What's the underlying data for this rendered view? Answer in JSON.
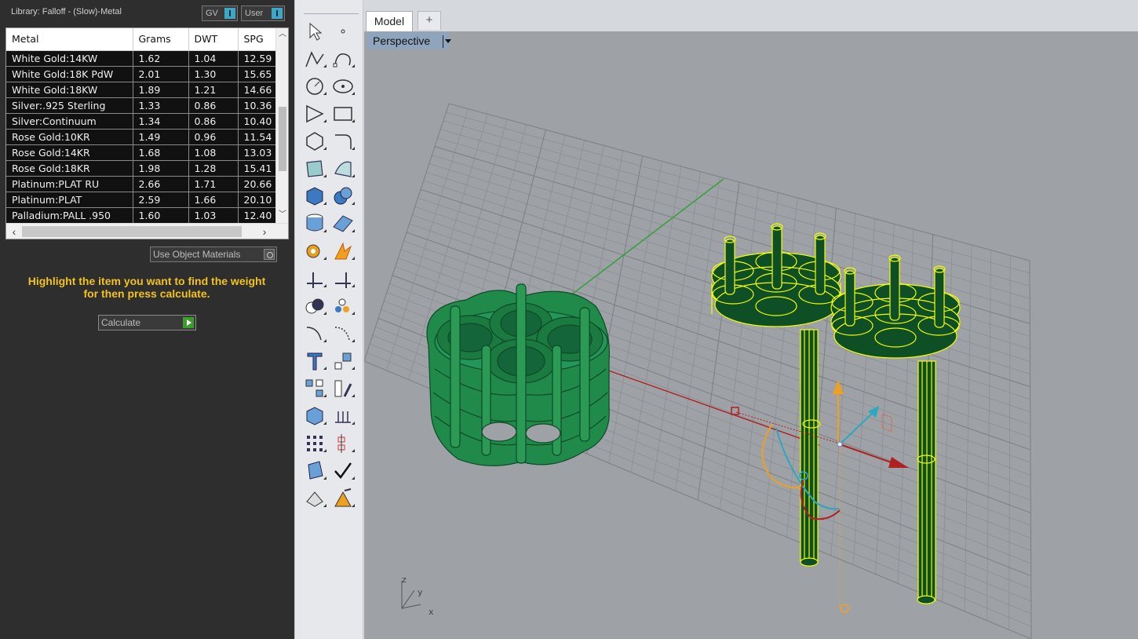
{
  "library": {
    "title": "Library: Falloff - (Slow)-Metal",
    "gv_label": "GV",
    "user_label": "User"
  },
  "metal_table": {
    "columns": [
      "Metal",
      "Grams",
      "DWT",
      "SPG"
    ],
    "rows": [
      [
        "White Gold:14KW",
        "1.62",
        "1.04",
        "12.59"
      ],
      [
        "White Gold:18K PdW",
        "2.01",
        "1.30",
        "15.65"
      ],
      [
        "White Gold:18KW",
        "1.89",
        "1.21",
        "14.66"
      ],
      [
        "Silver:.925 Sterling",
        "1.33",
        "0.86",
        "10.36"
      ],
      [
        "Silver:Continuum",
        "1.34",
        "0.86",
        "10.40"
      ],
      [
        "Rose Gold:10KR",
        "1.49",
        "0.96",
        "11.54"
      ],
      [
        "Rose Gold:14KR",
        "1.68",
        "1.08",
        "13.03"
      ],
      [
        "Rose Gold:18KR",
        "1.98",
        "1.28",
        "15.41"
      ],
      [
        "Platinum:PLAT RU",
        "2.66",
        "1.71",
        "20.66"
      ],
      [
        "Platinum:PLAT",
        "2.59",
        "1.66",
        "20.10"
      ],
      [
        "Palladium:PALL .950",
        "1.60",
        "1.03",
        "12.40"
      ]
    ]
  },
  "options": {
    "use_object_materials": "Use Object Materials"
  },
  "instructions": {
    "line1": "Highlight the item you want to find the weight",
    "line2": "for then press calculate."
  },
  "calculate": {
    "label": "Calculate"
  },
  "tabs": {
    "model": "Model",
    "add": "+"
  },
  "viewport": {
    "name": "Perspective",
    "axis_labels": {
      "z": "z",
      "y": "y",
      "x": "x"
    }
  },
  "tools": [
    "select-arrow-icon",
    "point-icon",
    "polyline-icon",
    "curve-icon",
    "circle-icon",
    "ellipse-icon",
    "arc-icon",
    "rectangle-icon",
    "polygon-icon",
    "fillet-curve-icon",
    "surface-from-points-icon",
    "surface-edit-icon",
    "box-icon",
    "sphere-icon",
    "cylinder-tube-icon",
    "mesh-icon",
    "gear-settings-icon",
    "explode-icon",
    "trim-icon",
    "split-icon",
    "boolean-icon",
    "group-icon",
    "offset-curve-icon",
    "blend-curve-icon",
    "text-icon",
    "scale-icon",
    "array-icon",
    "mirror-icon",
    "render-box-icon",
    "dimension-icon",
    "grid-array-icon",
    "align-icon",
    "flow-along-icon",
    "check-icon",
    "solid-tools-icon",
    "analysis-icon"
  ],
  "colors": {
    "panel_bg": "#2e2e2e",
    "instruction_text": "#f3c21b",
    "viewport_bg": "#9ea2a7",
    "ring_green": "#1f8a4a",
    "selection_yellow": "#f2ff00",
    "x_axis": "#b02020",
    "y_axis": "#3aa040",
    "gumball_z": "#f0a020",
    "gumball_y": "#2aa8c0"
  }
}
